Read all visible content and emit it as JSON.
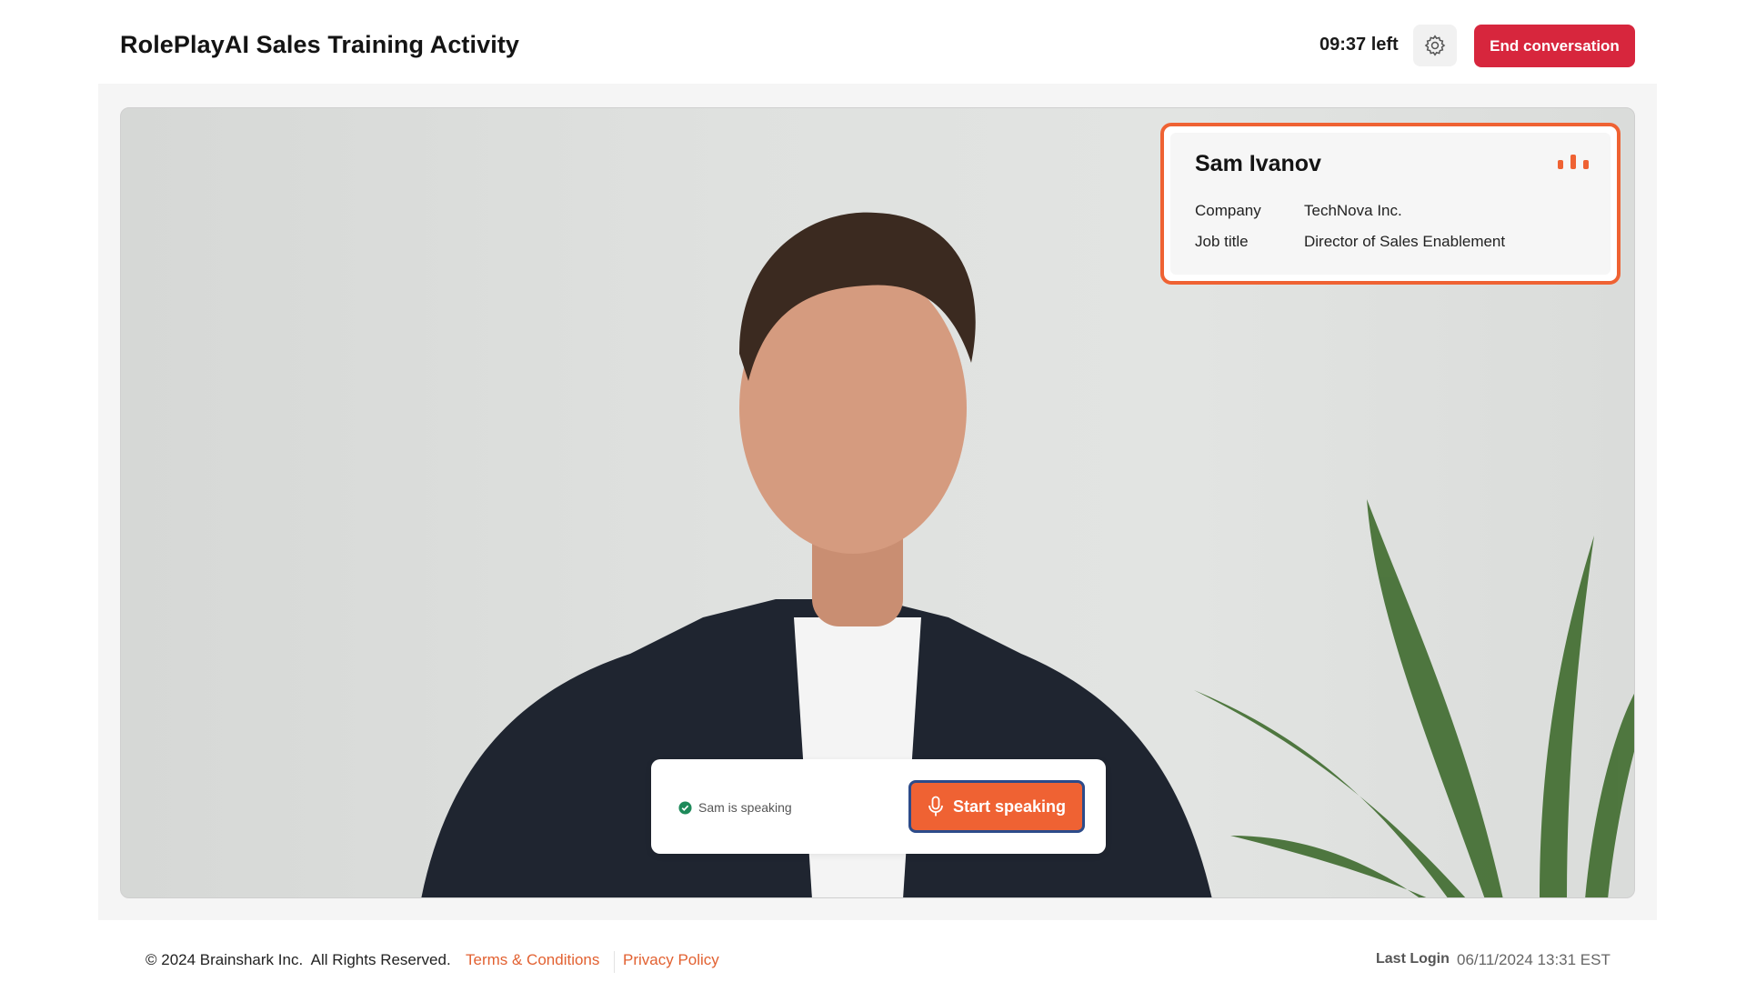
{
  "header": {
    "title": "RolePlayAI Sales Training Activity",
    "timer": "09:37 left",
    "settings_icon": "gear-icon",
    "end_button": "End conversation",
    "colors": {
      "end_button_bg": "#d7263d"
    }
  },
  "contact": {
    "name": "Sam Ivanov",
    "activity_icon": "audio-bars-icon",
    "rows": [
      {
        "label": "Company",
        "value": "TechNova Inc."
      },
      {
        "label": "Job title",
        "value": "Director of Sales Enablement"
      }
    ],
    "colors": {
      "accent": "#ef6233"
    }
  },
  "speak_panel": {
    "status_icon": "check-circle-icon",
    "status_text": "Sam is speaking",
    "start_button": "Start speaking",
    "mic_icon": "microphone-icon",
    "colors": {
      "status_ok": "#1e8a5a",
      "button_bg": "#ef6233",
      "button_border": "#2c4b8a"
    }
  },
  "footer": {
    "copyright": "© 2024 Brainshark Inc.  All Rights Reserved.",
    "terms_link": "Terms & Conditions",
    "privacy_link": "Privacy Policy",
    "last_login_label": "Last Login",
    "last_login_value": "06/11/2024 13:31 EST",
    "colors": {
      "link": "#e26131"
    }
  }
}
